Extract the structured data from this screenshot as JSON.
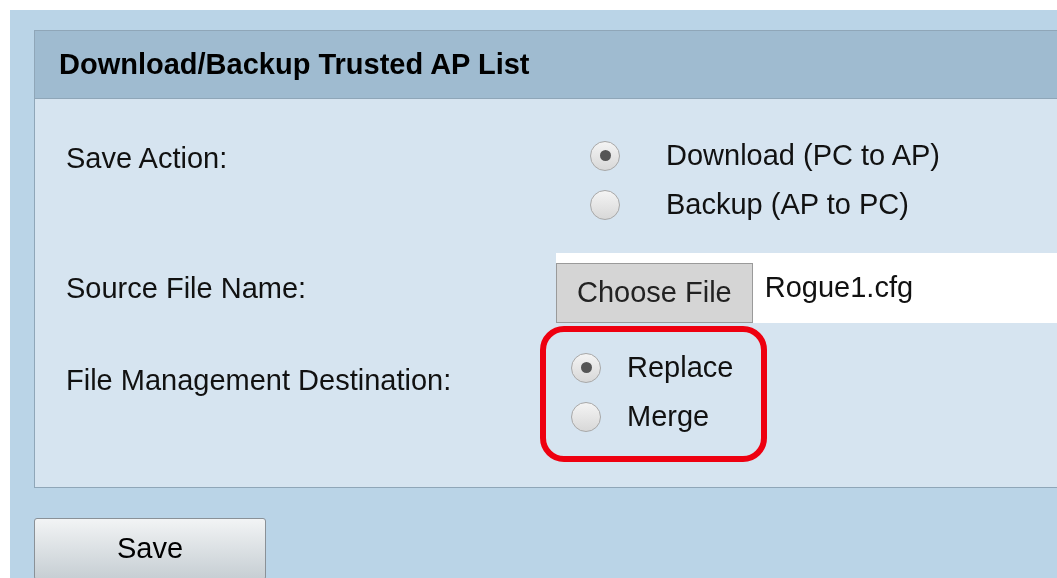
{
  "panel": {
    "title": "Download/Backup Trusted AP List",
    "save_action": {
      "label": "Save Action:",
      "options": [
        {
          "label": "Download (PC to AP)",
          "selected": true
        },
        {
          "label": "Backup (AP to PC)",
          "selected": false
        }
      ]
    },
    "source_file": {
      "label": "Source File Name:",
      "button": "Choose File",
      "value": "Rogue1.cfg"
    },
    "destination": {
      "label": "File Management Destination:",
      "highlighted": true,
      "options": [
        {
          "label": "Replace",
          "selected": true
        },
        {
          "label": "Merge",
          "selected": false
        }
      ]
    }
  },
  "buttons": [
    "Save"
  ]
}
